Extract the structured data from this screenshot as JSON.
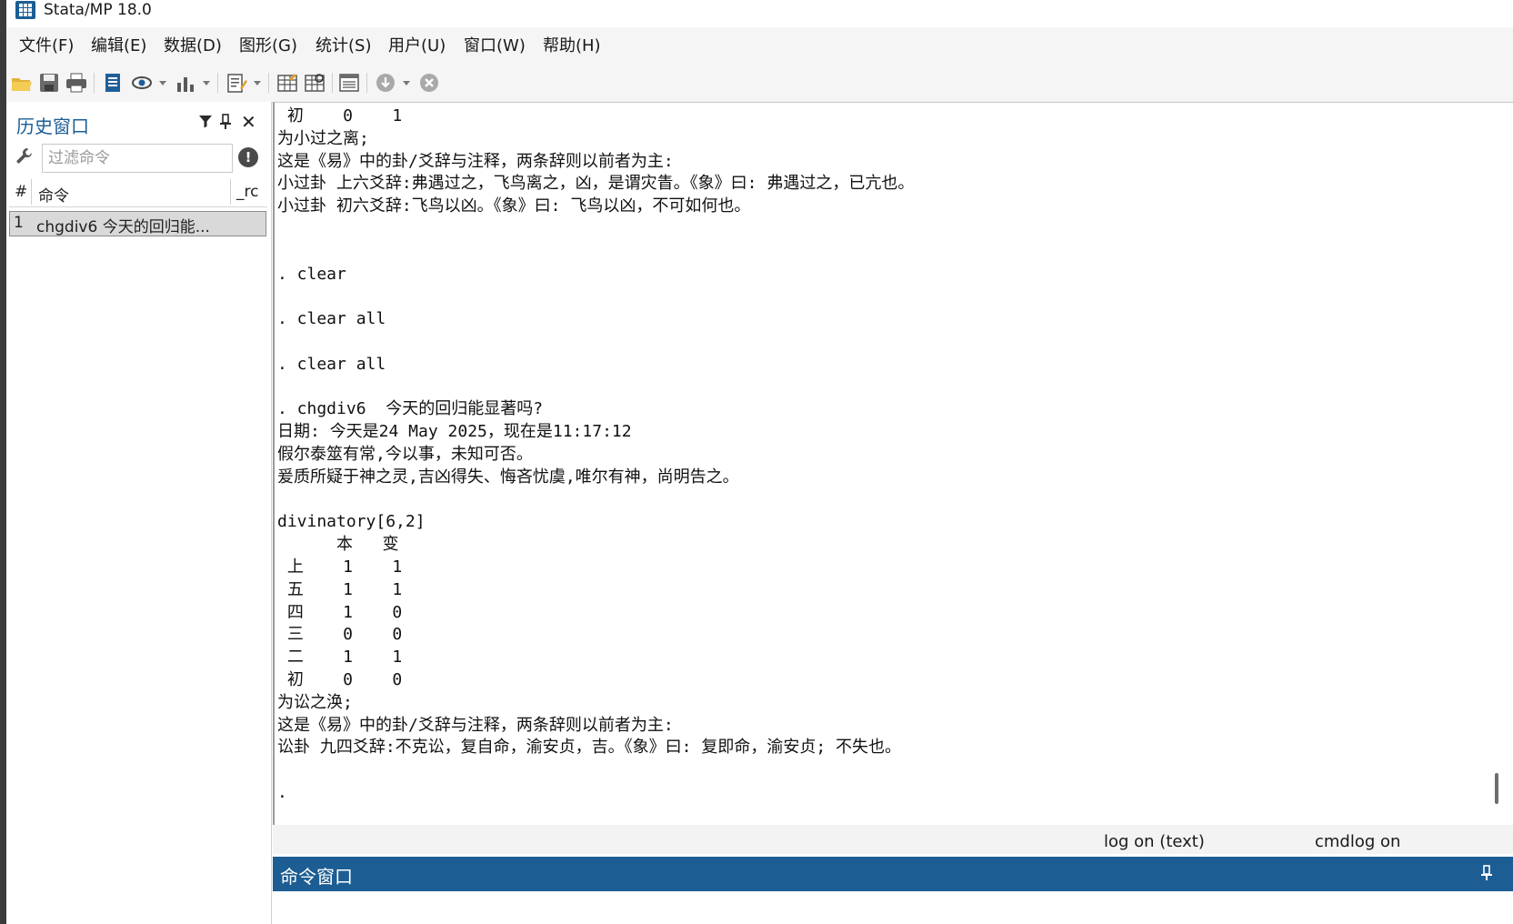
{
  "app": {
    "title": "Stata/MP 18.0"
  },
  "menu": {
    "items": [
      "文件(F)",
      "编辑(E)",
      "数据(D)",
      "图形(G)",
      "统计(S)",
      "用户(U)",
      "窗口(W)",
      "帮助(H)"
    ]
  },
  "toolbar": {
    "icons": [
      "open-icon",
      "save-icon",
      "print-icon",
      "log-icon",
      "viewer-icon",
      "graph-icon",
      "do-file-editor-icon",
      "data-editor-icon",
      "data-browser-icon",
      "variables-manager-icon",
      "more-icon",
      "break-icon"
    ]
  },
  "history": {
    "title": "历史窗口",
    "filter_placeholder": "过滤命令",
    "columns": {
      "num": "#",
      "command": "命令",
      "rc": "_rc"
    },
    "rows": [
      {
        "num": "1",
        "command": "chgdiv6  今天的回归能..."
      }
    ]
  },
  "results": {
    "lines": [
      " 初    0    1",
      "为小过之离;",
      "这是《易》中的卦/爻辞与注释，两条辞则以前者为主:",
      "小过卦 上六爻辞:弗遇过之，飞鸟离之，凶，是谓灾眚。《象》曰: 弗遇过之，已亢也。",
      "小过卦 初六爻辞:飞鸟以凶。《象》曰: 飞鸟以凶，不可如何也。",
      "",
      "",
      ". clear",
      "",
      ". clear all",
      "",
      ". clear all",
      "",
      ". chgdiv6  今天的回归能显著吗?",
      "日期: 今天是24 May 2025，现在是11:17:12",
      "假尔泰筮有常,今以事，未知可否。",
      "爰质所疑于神之灵,吉凶得失、悔吝忧虞,唯尔有神，尚明告之。",
      "",
      "divinatory[6,2]",
      "      本   变",
      " 上    1    1",
      " 五    1    1",
      " 四    1    0",
      " 三    0    0",
      " 二    1    1",
      " 初    0    0",
      "为讼之涣;",
      "这是《易》中的卦/爻辞与注释，两条辞则以前者为主:",
      "讼卦 九四爻辞:不克讼，复自命，渝安贞，吉。《象》曰: 复即命，渝安贞; 不失也。",
      "",
      "."
    ]
  },
  "status": {
    "log": "log on (text)",
    "cmdlog": "cmdlog on"
  },
  "command_window": {
    "title": "命令窗口"
  },
  "colors": {
    "accent": "#1c5d93",
    "history_title": "#1b5e96"
  }
}
